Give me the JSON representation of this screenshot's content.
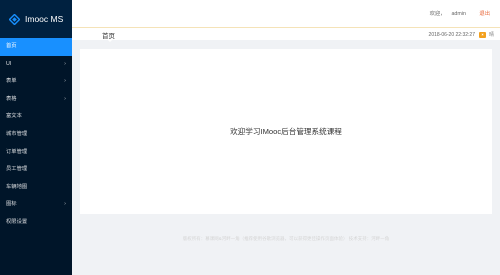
{
  "app": {
    "logo_text": "Imooc MS"
  },
  "sidebar": {
    "items": [
      {
        "label": "首页",
        "active": true,
        "has_children": false
      },
      {
        "label": "UI",
        "active": false,
        "has_children": true
      },
      {
        "label": "表单",
        "active": false,
        "has_children": true
      },
      {
        "label": "表格",
        "active": false,
        "has_children": true
      },
      {
        "label": "富文本",
        "active": false,
        "has_children": false
      },
      {
        "label": "城市管理",
        "active": false,
        "has_children": false
      },
      {
        "label": "订单管理",
        "active": false,
        "has_children": false
      },
      {
        "label": "员工管理",
        "active": false,
        "has_children": false
      },
      {
        "label": "车辆地图",
        "active": false,
        "has_children": false
      },
      {
        "label": "图标",
        "active": false,
        "has_children": true
      },
      {
        "label": "权限设置",
        "active": false,
        "has_children": false
      }
    ],
    "chevron": "›"
  },
  "header": {
    "greeting": "欢迎，",
    "username": "admin",
    "logout": "退出"
  },
  "breadcrumb": {
    "title": "首页",
    "datetime": "2018-06-20 22:32:27",
    "weather_icon": "sun-icon",
    "weather_text": "晴"
  },
  "main": {
    "welcome": "欢迎学习IMooc后台管理系统课程"
  },
  "footer": {
    "text": "版权所有：慕课网&河畔一角（推荐使用谷歌浏览器，可以获得更佳操作页面体验） 技术支持：河畔一角"
  },
  "colors": {
    "sidebar_bg": "#001529",
    "active_item": "#1890ff",
    "logout": "#e8683a",
    "weather_badge": "#f3a01d"
  }
}
